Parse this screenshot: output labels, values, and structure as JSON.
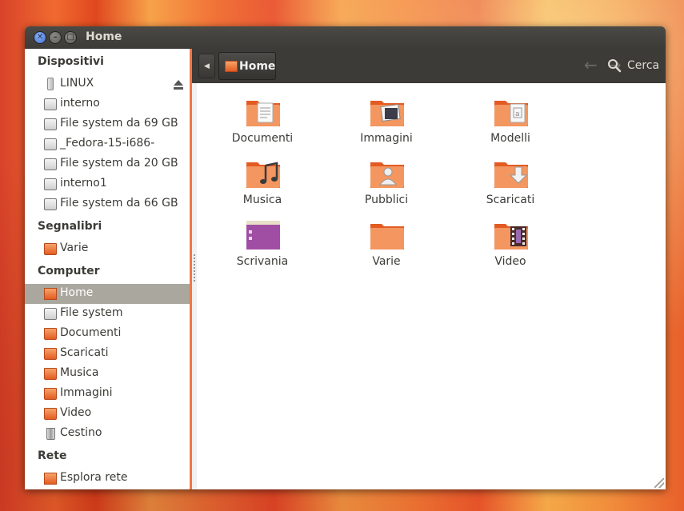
{
  "window": {
    "title": "Home"
  },
  "sidebar": {
    "sections": [
      {
        "title": "Dispositivi"
      },
      {
        "title": "Segnalibri"
      },
      {
        "title": "Computer"
      },
      {
        "title": "Rete"
      }
    ],
    "devices": [
      {
        "label": "LINUX",
        "icon": "usb-drive-icon"
      },
      {
        "label": "interno",
        "icon": "hard-drive-icon"
      },
      {
        "label": "File system da 69 GB",
        "icon": "hard-drive-icon"
      },
      {
        "label": "_Fedora-15-i686-",
        "icon": "hard-drive-icon"
      },
      {
        "label": "File system da 20 GB",
        "icon": "hard-drive-icon"
      },
      {
        "label": "interno1",
        "icon": "hard-drive-icon"
      },
      {
        "label": "File system da 66 GB",
        "icon": "hard-drive-icon"
      }
    ],
    "bookmarks": [
      {
        "label": "Varie",
        "icon": "folder-icon"
      }
    ],
    "computer": [
      {
        "label": "Home",
        "icon": "home-folder-icon",
        "selected": true
      },
      {
        "label": "File system",
        "icon": "hard-drive-icon"
      },
      {
        "label": "Documenti",
        "icon": "documents-folder-icon"
      },
      {
        "label": "Scaricati",
        "icon": "downloads-folder-icon"
      },
      {
        "label": "Musica",
        "icon": "music-folder-icon"
      },
      {
        "label": "Immagini",
        "icon": "pictures-folder-icon"
      },
      {
        "label": "Video",
        "icon": "video-folder-icon"
      },
      {
        "label": "Cestino",
        "icon": "trash-icon"
      }
    ],
    "network": [
      {
        "label": "Esplora rete",
        "icon": "network-folder-icon"
      }
    ]
  },
  "toolbar": {
    "breadcrumb": "Home",
    "search_label": "Cerca"
  },
  "files": [
    {
      "label": "Documenti",
      "icon": "documents-folder-icon"
    },
    {
      "label": "Immagini",
      "icon": "pictures-folder-icon"
    },
    {
      "label": "Modelli",
      "icon": "templates-folder-icon"
    },
    {
      "label": "Musica",
      "icon": "music-folder-icon"
    },
    {
      "label": "Pubblici",
      "icon": "public-folder-icon"
    },
    {
      "label": "Scaricati",
      "icon": "downloads-folder-icon"
    },
    {
      "label": "Scrivania",
      "icon": "desktop-folder-icon"
    },
    {
      "label": "Varie",
      "icon": "folder-icon"
    },
    {
      "label": "Video",
      "icon": "video-folder-icon"
    }
  ],
  "colors": {
    "accent": "#f07746",
    "titlebar": "#3c3b37",
    "selection": "#aaa79f"
  }
}
